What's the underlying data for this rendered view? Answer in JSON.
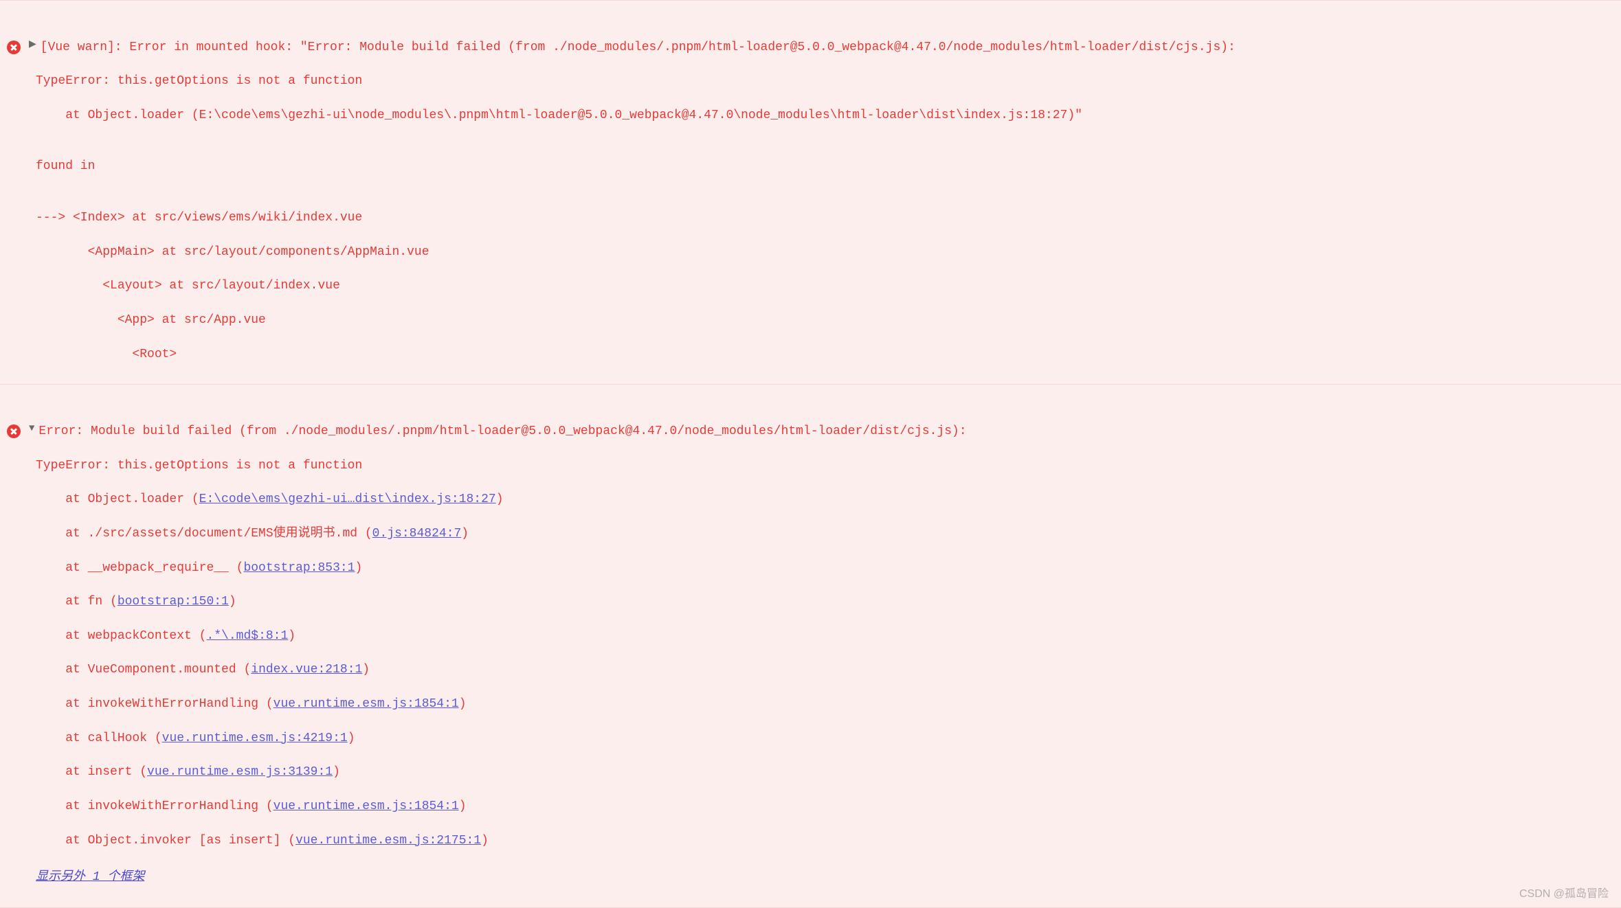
{
  "messages": [
    {
      "expanded": false,
      "headline": "[Vue warn]: Error in mounted hook: \"Error: Module build failed (from ./node_modules/.pnpm/html-loader@5.0.0_webpack@4.47.0/node_modules/html-loader/dist/cjs.js):",
      "lines": [
        "TypeError: this.getOptions is not a function",
        "    at Object.loader (E:\\code\\ems\\gezhi-ui\\node_modules\\.pnpm\\html-loader@5.0.0_webpack@4.47.0\\node_modules\\html-loader\\dist\\index.js:18:27)\"",
        "",
        "found in",
        "",
        "---> <Index> at src/views/ems/wiki/index.vue",
        "       <AppMain> at src/layout/components/AppMain.vue",
        "         <Layout> at src/layout/index.vue",
        "           <App> at src/App.vue",
        "             <Root>"
      ]
    },
    {
      "expanded": true,
      "headline": "Error: Module build failed (from ./node_modules/.pnpm/html-loader@5.0.0_webpack@4.47.0/node_modules/html-loader/dist/cjs.js):",
      "lines": [
        "TypeError: this.getOptions is not a function"
      ],
      "stack": [
        {
          "prefix": "    at Object.loader (",
          "link": "E:\\code\\ems\\gezhi-ui…dist\\index.js:18:27",
          "suffix": ")"
        },
        {
          "prefix": "    at ./src/assets/document/EMS使用说明书.md (",
          "link": "0.js:84824:7",
          "suffix": ")"
        },
        {
          "prefix": "    at __webpack_require__ (",
          "link": "bootstrap:853:1",
          "suffix": ")"
        },
        {
          "prefix": "    at fn (",
          "link": "bootstrap:150:1",
          "suffix": ")"
        },
        {
          "prefix": "    at webpackContext (",
          "link": ".*\\.md$:8:1",
          "suffix": ")"
        },
        {
          "prefix": "    at VueComponent.mounted (",
          "link": "index.vue:218:1",
          "suffix": ")"
        },
        {
          "prefix": "    at invokeWithErrorHandling (",
          "link": "vue.runtime.esm.js:1854:1",
          "suffix": ")"
        },
        {
          "prefix": "    at callHook (",
          "link": "vue.runtime.esm.js:4219:1",
          "suffix": ")"
        },
        {
          "prefix": "    at insert (",
          "link": "vue.runtime.esm.js:3139:1",
          "suffix": ")"
        },
        {
          "prefix": "    at invokeWithErrorHandling (",
          "link": "vue.runtime.esm.js:1854:1",
          "suffix": ")"
        },
        {
          "prefix": "    at Object.invoker [as insert] (",
          "link": "vue.runtime.esm.js:2175:1",
          "suffix": ")"
        }
      ],
      "show_more": "显示另外 1 个框架"
    }
  ],
  "watermark": "CSDN @孤岛冒险"
}
